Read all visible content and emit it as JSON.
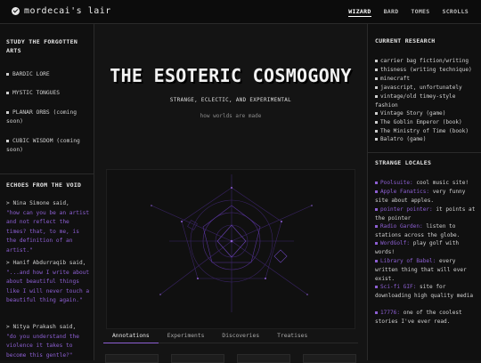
{
  "site": {
    "title": "mordecai's lair",
    "logo_icon": "check-circle-icon"
  },
  "nav": {
    "items": [
      "WIZARD",
      "BARD",
      "TOMES",
      "SCROLLS"
    ],
    "active": "WIZARD"
  },
  "left": {
    "study_title": "STUDY THE FORGOTTEN ARTS",
    "study_items": [
      "BARDIC LORE",
      "MYSTIC TONGUES",
      "PLANAR ORBS (coming soon)",
      "CUBIC WISDOM (coming soon)"
    ],
    "echoes_title": "ECHOES FROM THE VOID",
    "echoes": [
      {
        "author": "> Nina Simone said,",
        "quote": "\"how can you be an artist and not reflect the times? that, to me, is the definition of an artist.\""
      },
      {
        "author": "> Hanif Abdurraqib said,",
        "quote": "\"...and how I write about about beautiful things like I will never touch a beautiful thing again.\""
      },
      {
        "author": "> Nitya Prakash said,",
        "quote": "\"do you understand the violence it takes to become this gentle?\""
      }
    ]
  },
  "hero": {
    "title": "THE ESOTERIC COSMOGONY",
    "subtitle": "STRANGE, ECLECTIC, AND EXPERIMENTAL",
    "tagline": "how worlds are made"
  },
  "tabs": [
    "Annotations",
    "Experiments",
    "Discoveries",
    "Treatises"
  ],
  "active_tab": "Annotations",
  "right": {
    "research_title": "CURRENT RESEARCH",
    "research_items": [
      "carrier bag fiction/writing",
      "thisness (writing technique)",
      "minecraft",
      "javascript, unfortunately",
      "vintage/old timey-style fashion",
      "Vintage Story (game)",
      "The Goblin Emperor (book)",
      "The Ministry of Time (book)",
      "Balatro (game)"
    ],
    "locales_title": "STRANGE LOCALES",
    "locales": [
      {
        "name": "Poolsuite:",
        "desc": "cool music site!"
      },
      {
        "name": "Apple Fanatics:",
        "desc": "very funny site about apples."
      },
      {
        "name": "pointer pointer:",
        "desc": "it points at the pointer"
      },
      {
        "name": "Radio Garden:",
        "desc": "listen to stations across the globe."
      },
      {
        "name": "WordGolf:",
        "desc": "play golf with words!"
      },
      {
        "name": "Library of Babel:",
        "desc": "every written thing that will ever exist."
      },
      {
        "name": "Sci-fi GIF:",
        "desc": "site for downloading high quality media"
      },
      {
        "name": "17776:",
        "desc": "one of the coolest stories I've ever read."
      }
    ]
  },
  "colors": {
    "accent": "#8d5fd3",
    "background": "#151515",
    "panel": "#101010"
  }
}
